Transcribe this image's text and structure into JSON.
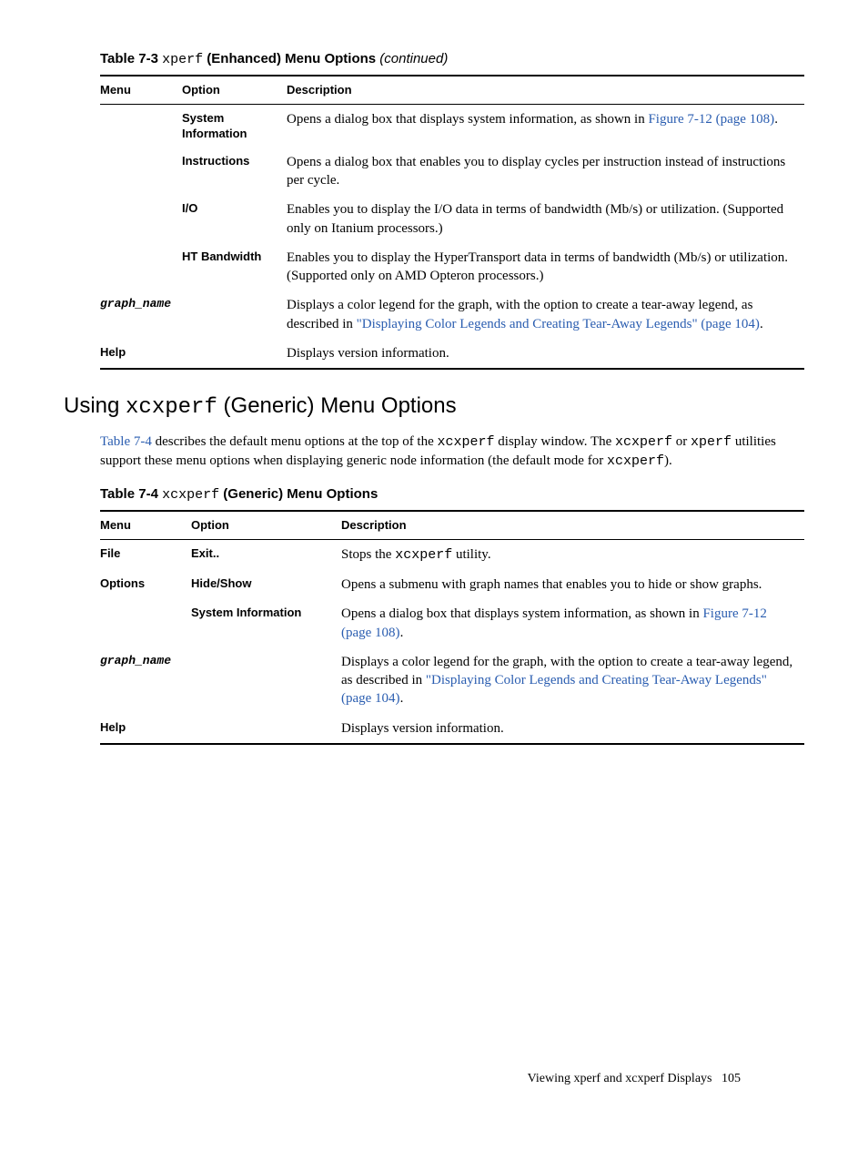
{
  "table73": {
    "caption_label": "Table 7-3",
    "caption_code": "xperf",
    "caption_rest": " (Enhanced) Menu Options ",
    "caption_cont": "(continued)",
    "headers": {
      "menu": "Menu",
      "option": "Option",
      "description": "Description"
    },
    "rows": {
      "sysinfo": {
        "option1": "System",
        "option2": "Information",
        "desc_pre": "Opens a dialog box that displays system information, as shown in ",
        "desc_link": "Figure 7-12 (page 108)",
        "desc_post": "."
      },
      "instructions": {
        "option": "Instructions",
        "desc": "Opens a dialog box that enables you to display cycles per instruction instead of instructions per cycle."
      },
      "io": {
        "option": "I/O",
        "desc": "Enables you to display the I/O data in terms of bandwidth (Mb/s) or utilization. (Supported only on Itanium processors.)"
      },
      "ht": {
        "option": "HT Bandwidth",
        "desc": "Enables you to display the HyperTransport data in terms of bandwidth (Mb/s) or utilization. (Supported only on AMD Opteron processors.)"
      },
      "graph": {
        "menu": "graph_name",
        "desc_pre": "Displays a color legend for the graph, with the option to create a tear-away legend, as described in ",
        "desc_link": "\"Displaying Color Legends and Creating Tear-Away Legends\" (page 104)",
        "desc_post": "."
      },
      "help": {
        "menu": "Help",
        "desc": "Displays version information."
      }
    }
  },
  "section": {
    "title_pre": "Using ",
    "title_code": "xcxperf",
    "title_post": " (Generic) Menu Options",
    "para_link": "Table 7-4",
    "para_1a": " describes the default menu options at the top of the ",
    "para_1c1": "xcxperf",
    "para_1b": " display window. The ",
    "para_1c2": "xcxperf",
    "para_1c": " or ",
    "para_1c3": "xperf",
    "para_1d": " utilities support these menu options when displaying generic node information (the default mode for ",
    "para_1c4": "xcxperf",
    "para_1e": ")."
  },
  "table74": {
    "caption_label": "Table 7-4",
    "caption_code": "xcxperf",
    "caption_rest": " (Generic) Menu Options",
    "headers": {
      "menu": "Menu",
      "option": "Option",
      "description": "Description"
    },
    "rows": {
      "file": {
        "menu": "File",
        "option": "Exit..",
        "desc_pre": "Stops the ",
        "desc_code": "xcxperf",
        "desc_post": " utility."
      },
      "options": {
        "menu": "Options",
        "option": "Hide/Show",
        "desc": "Opens a submenu with graph names that enables you to hide or show graphs."
      },
      "sysinfo": {
        "option": "System Information",
        "desc_pre": "Opens a dialog box that displays system information, as shown in ",
        "desc_link": "Figure 7-12 (page 108)",
        "desc_post": "."
      },
      "graph": {
        "menu": "graph_name",
        "desc_pre": "Displays a color legend for the graph, with the option to create a tear-away legend, as described in ",
        "desc_link": "\"Displaying Color Legends and Creating Tear-Away Legends\" (page 104)",
        "desc_post": "."
      },
      "help": {
        "menu": "Help",
        "desc": "Displays version information."
      }
    }
  },
  "footer": {
    "text": "Viewing xperf and xcxperf Displays",
    "page": "105"
  }
}
